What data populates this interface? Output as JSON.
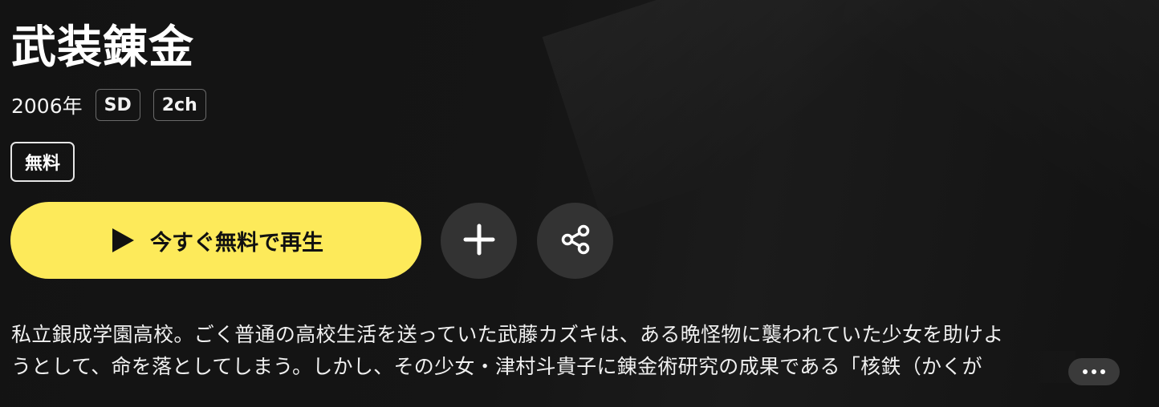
{
  "title": "武装錬金",
  "meta": {
    "year": "2006年",
    "badges": [
      "SD",
      "2ch"
    ]
  },
  "free_badge": "無料",
  "actions": {
    "play_label": "今すぐ無料で再生",
    "play_icon": "play-icon",
    "add_icon": "plus-icon",
    "share_icon": "share-icon",
    "more_icon": "ellipsis-icon"
  },
  "description": {
    "line1": "私立銀成学園高校。ごく普通の高校生活を送っていた武藤カズキは、ある晩怪物に襲われていた少女を助けよ",
    "line2": "うとして、命を落としてしまう。しかし、その少女・津村斗貴子に錬金術研究の成果である「核鉄（かくが"
  },
  "colors": {
    "background": "#141414",
    "accent": "#fdea5a",
    "circle_button": "#333333"
  }
}
